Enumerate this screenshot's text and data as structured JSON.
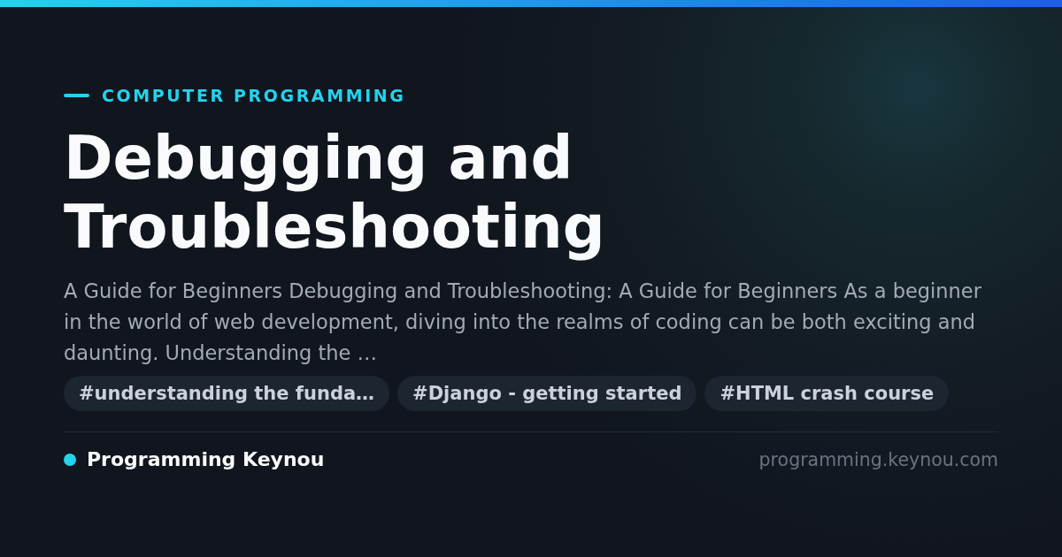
{
  "category": "COMPUTER PROGRAMMING",
  "title": "Debugging and Troubleshooting",
  "description": "A Guide for Beginners Debugging and Troubleshooting: A Guide for Beginners As a beginner in the world of web development, diving into the realms of coding can be both exciting and daunting. Understanding the …",
  "tags": [
    "#understanding the funda…",
    "#Django - getting started",
    "#HTML crash course"
  ],
  "site": {
    "name": "Programming Keynou",
    "domain": "programming.keynou.com"
  }
}
